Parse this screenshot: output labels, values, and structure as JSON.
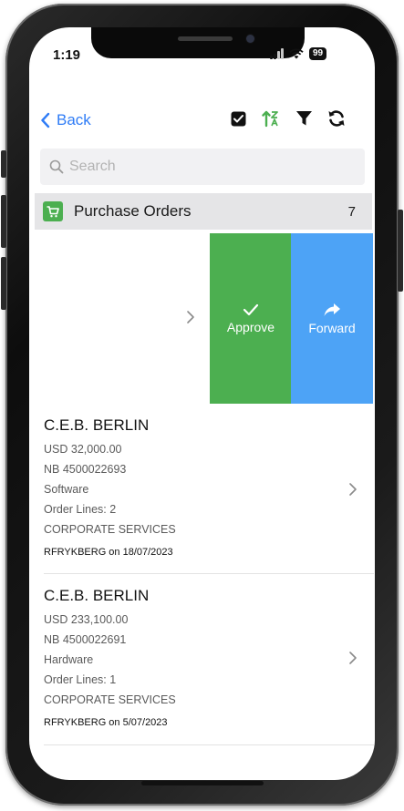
{
  "status_bar": {
    "time": "1:19",
    "battery": "99"
  },
  "nav": {
    "back_label": "Back",
    "toolbar_icons": [
      "checkbox-icon",
      "sort-icon",
      "filter-icon",
      "refresh-icon"
    ]
  },
  "search": {
    "placeholder": "Search"
  },
  "section": {
    "title": "Purchase Orders",
    "count": "7"
  },
  "swipe_actions": {
    "approve": "Approve",
    "forward": "Forward"
  },
  "orders": [
    {
      "company": "C.E.B. BERLIN",
      "amount": "USD 32,000.00",
      "number": "NB 4500022693",
      "category": "Software",
      "lines": "Order Lines: 2",
      "department": "CORPORATE SERVICES",
      "requester": "RFRYKBERG on 18/07/2023"
    },
    {
      "company": "C.E.B. BERLIN",
      "amount": "USD 233,100.00",
      "number": "NB 4500022691",
      "category": "Hardware",
      "lines": "Order Lines: 1",
      "department": "CORPORATE SERVICES",
      "requester": "RFRYKBERG on 5/07/2023"
    }
  ],
  "colors": {
    "accent": "#2f7cf6",
    "approve": "#4caf50",
    "forward": "#4da3f6",
    "section_bg": "#e5e5e7",
    "search_bg": "#f1f1f3"
  }
}
